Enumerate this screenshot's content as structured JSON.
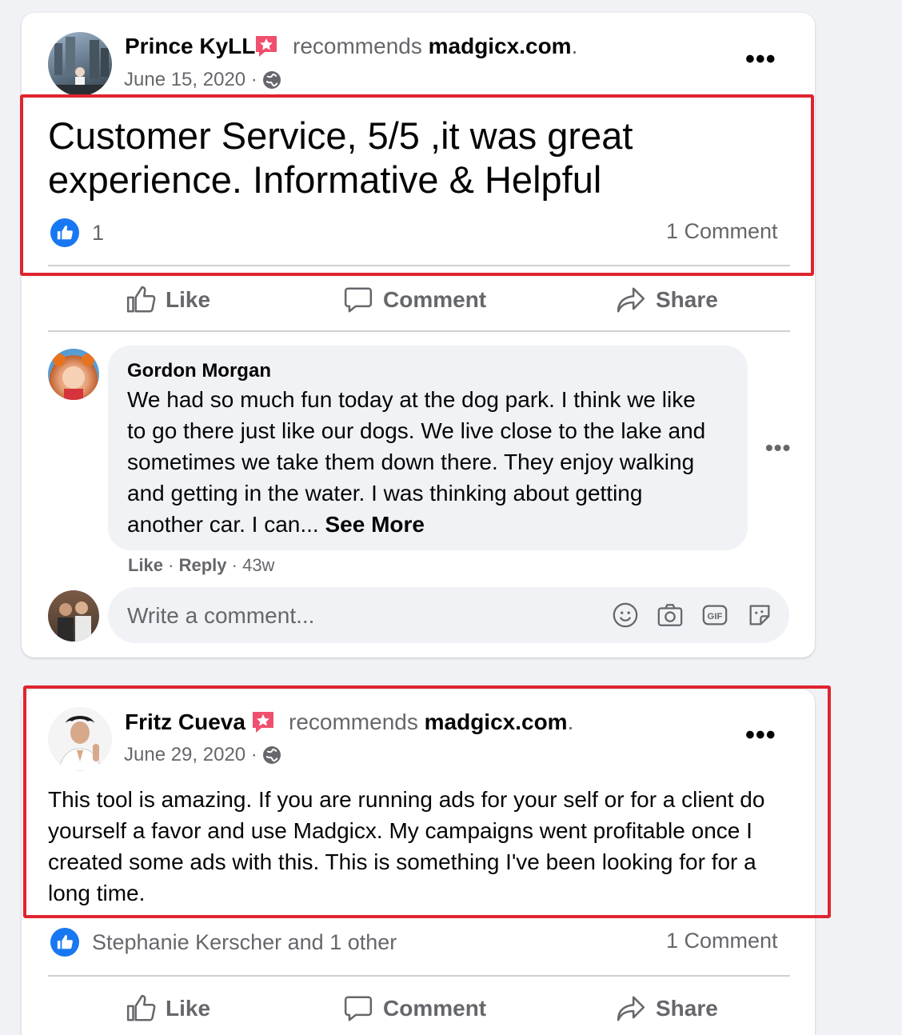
{
  "post1": {
    "author": "Prince KyLL",
    "recommends_text": "recommends",
    "site": "madgicx.com",
    "site_suffix": ".",
    "date": "June 15, 2020 ·",
    "more": "•••",
    "text_line1": "Customer Service, 5/5 ,it was great",
    "text_line2": "experience. Informative & Helpful",
    "reaction_count": "1",
    "comment_count": "1 Comment",
    "actions": {
      "like": "Like",
      "comment": "Comment",
      "share": "Share"
    },
    "comment": {
      "author": "Gordon Morgan",
      "text": "We had so much fun today at the dog park. I think we like to go there just like our dogs. We live close to the lake and sometimes we take them down there. They enjoy walking and getting in the water. I was thinking about getting another car. I can...",
      "see_more": "See More",
      "meta_like": "Like",
      "meta_sep1": " · ",
      "meta_reply": "Reply",
      "meta_sep2": " · ",
      "meta_time": "43w",
      "more": "•••"
    },
    "write_placeholder": "Write a comment..."
  },
  "post2": {
    "author": "Fritz Cueva",
    "recommends_text": "recommends",
    "site": "madgicx.com",
    "site_suffix": ".",
    "date": "June 29, 2020 ·",
    "more": "•••",
    "text": "This tool is amazing. If you are running ads for your self or for a client do yourself a favor and use Madgicx. My campaigns went profitable once I created some ads with this. This is something I've been looking for for a long time.",
    "reactors": "Stephanie Kerscher and 1 other",
    "comment_count": "1 Comment",
    "actions": {
      "like": "Like",
      "comment": "Comment",
      "share": "Share"
    }
  },
  "colors": {
    "accent": "#1877f2",
    "highlight": "#e0242f",
    "badge": "#f0506e"
  },
  "icons": [
    "globe-icon",
    "recommend-badge-icon",
    "thumbs-up-icon",
    "comment-icon",
    "share-icon",
    "smiley-icon",
    "camera-icon",
    "gif-icon",
    "sticker-icon"
  ]
}
